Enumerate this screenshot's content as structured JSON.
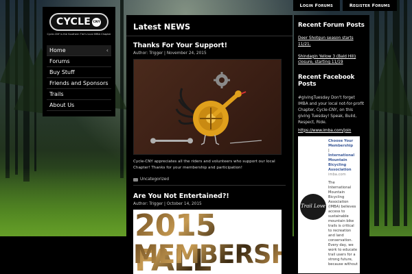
{
  "topbar": {
    "login": "Login Forums",
    "register": "Register Forums"
  },
  "logo": {
    "name": "CYCLE",
    "badge": "CNY",
    "tagline": "Cycle-CNY is the Southern Tier's local IMBA Chapter"
  },
  "nav": {
    "items": [
      "Home",
      "Forums",
      "Buy Stuff",
      "Friends and Sponsors",
      "Trails",
      "About Us"
    ]
  },
  "main": {
    "heading": "Latest NEWS",
    "posts": [
      {
        "title": "Thanks For Your Support!",
        "author": "Author: Trigger",
        "date": "November 24, 2015",
        "excerpt": "Cycle-CNY appreciates all the riders and volunteers who support our local Chapter!  Thanks for your membership and participation!",
        "category": "Uncategorized"
      },
      {
        "title": "Are You Not Entertained?!",
        "author": "Author: Trigger",
        "date": "October 14, 2015",
        "image_line1": "2015 FALL",
        "image_line2": "MEMBERSHIP"
      }
    ]
  },
  "right": {
    "forum_heading": "Recent Forum Posts",
    "forum_posts": [
      "Deer Shotgun season starts 11/21.",
      "Shindagin Yellow 3 (Bald Hill) closure, starting 11/19"
    ],
    "fb_heading": "Recent Facebook Posts",
    "fb_text": "#givingTuesday Don't forget IMBA and your local not-for-profit Chapter, Cycle-CNY, on this giving Tuesday! Speak, Build, Respect, Ride.",
    "fb_link": "https://www.imba.com/join",
    "fb_card": {
      "link1": "Choose Your Membership",
      "sep": "|",
      "link2": "International Mountain Bicycling Association",
      "source": "imba.com",
      "body": "The International Mountain Bicycling Association (IMBA) believes access to sustainable mountain bike trails is critical to recreation and land conservation. Every day, we work to educate trail users for a strong future, because without",
      "logo_text": "Trail Love"
    }
  },
  "colors": {
    "panel": "#000000",
    "accent_link": "#3b5998"
  }
}
